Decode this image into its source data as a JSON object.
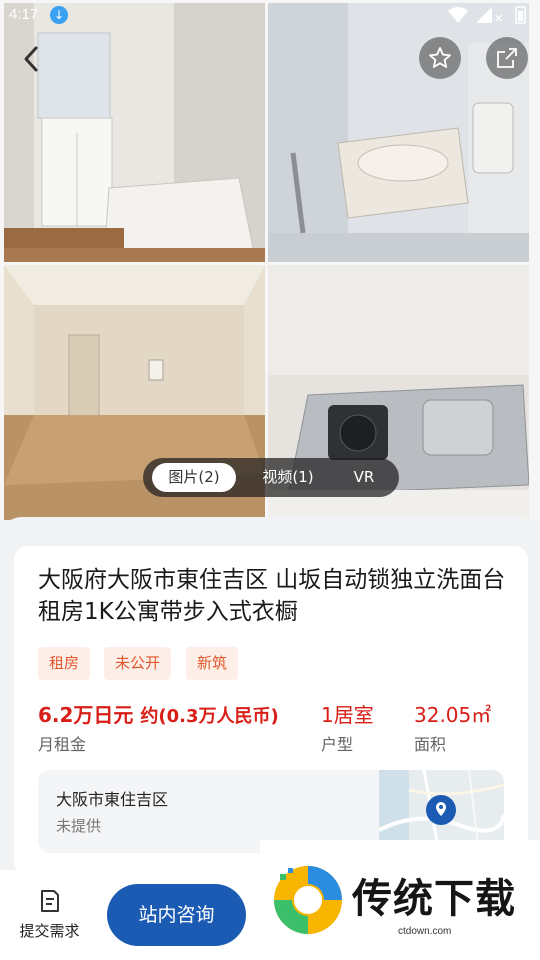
{
  "status_bar": {
    "time": "4:17",
    "download_icon": "download-arrow-icon",
    "icons": [
      "wifi-icon",
      "signal-icon",
      "battery-icon"
    ]
  },
  "media_tabs": {
    "photos": "图片(2)",
    "videos": "视频(1)",
    "vr": "VR",
    "active": "photos"
  },
  "listing": {
    "title": "大阪府大阪市東住吉区 山坂自动锁独立洗面台租房1K公寓带步入式衣橱",
    "tags": [
      "租房",
      "未公开",
      "新筑"
    ],
    "rent": {
      "value": "6.2万日元",
      "approx": "约(0.3万人民币)",
      "label": "月租金"
    },
    "layout": {
      "value": "1居室",
      "label": "户型"
    },
    "area": {
      "value": "32.05㎡",
      "label": "面积"
    },
    "address": {
      "district": "大阪市東住吉区",
      "detail": "未提供",
      "map_icon": "map-pin-icon"
    }
  },
  "bottom_bar": {
    "submit_label": "提交需求",
    "consult_label": "站内咨询"
  },
  "watermark": {
    "title": "传统下载",
    "url": "ctdown.com"
  },
  "colors": {
    "price_red": "#d91e18",
    "tag_bg": "#fdeee8",
    "tag_text": "#e2582d",
    "primary_blue": "#1c5bb4"
  }
}
